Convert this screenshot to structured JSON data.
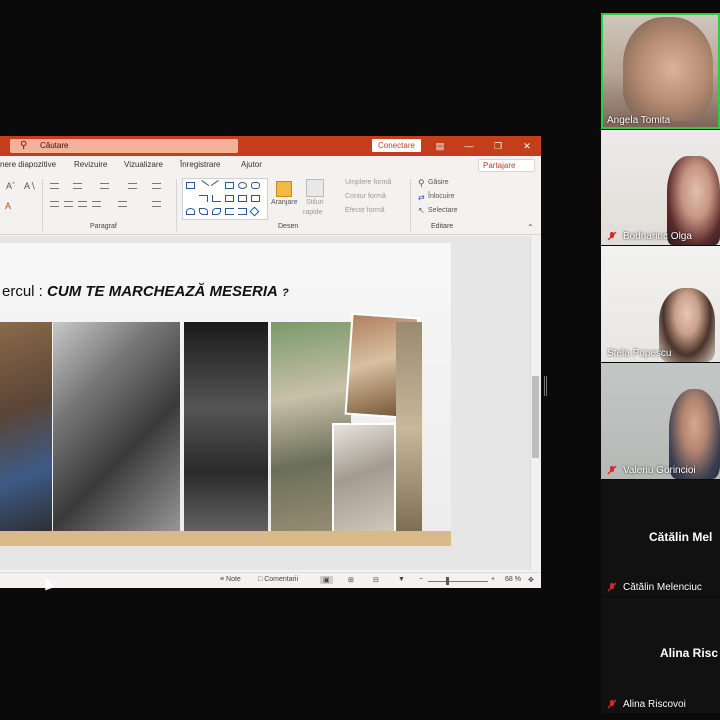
{
  "powerpoint": {
    "search_placeholder": "Căutare",
    "connect_label": "Conectare",
    "tabs": [
      "nere diapozitive",
      "Revizuire",
      "Vizualizare",
      "Înregistrare",
      "Ajutor"
    ],
    "share_label": "Partajare",
    "ribbon": {
      "group_paragraph": "Paragraf",
      "group_draw": "Desen",
      "group_edit": "Editare",
      "arrange": "Aranjare",
      "quick_styles_1": "Stiluri",
      "quick_styles_2": "rapide",
      "shape_fill": "Umplere formă",
      "shape_outline": "Contur formă",
      "shape_effects": "Efecte formă",
      "find": "Găsire",
      "replace": "Înlocuire",
      "select": "Selectare"
    },
    "slide": {
      "title_prefix": "ercul :",
      "title_bold": "CUM TE MARCHEAZĂ MESERIA",
      "title_q": "?"
    },
    "status": {
      "notes": "Note",
      "comments": "Comentarii",
      "zoom": "68 %"
    }
  },
  "participants": [
    {
      "name": "Angela Tomita",
      "muted": false,
      "active": true
    },
    {
      "name": "Bodnariuc Olga",
      "muted": true,
      "active": false
    },
    {
      "name": "Stela Popescu",
      "muted": false,
      "active": false
    },
    {
      "name": "Valeriu Gorincioi",
      "muted": true,
      "active": false
    },
    {
      "name": "Cătălin Melencіuc",
      "display": "Cătălin Mel",
      "muted": true,
      "active": false
    },
    {
      "name": "Alina Riscovoi",
      "display": "Alina Risc",
      "muted": true,
      "active": false
    }
  ],
  "colors": {
    "ppt_accent": "#c43e1c",
    "active_speaker": "#2ecc40",
    "muted_icon": "#e02424"
  }
}
